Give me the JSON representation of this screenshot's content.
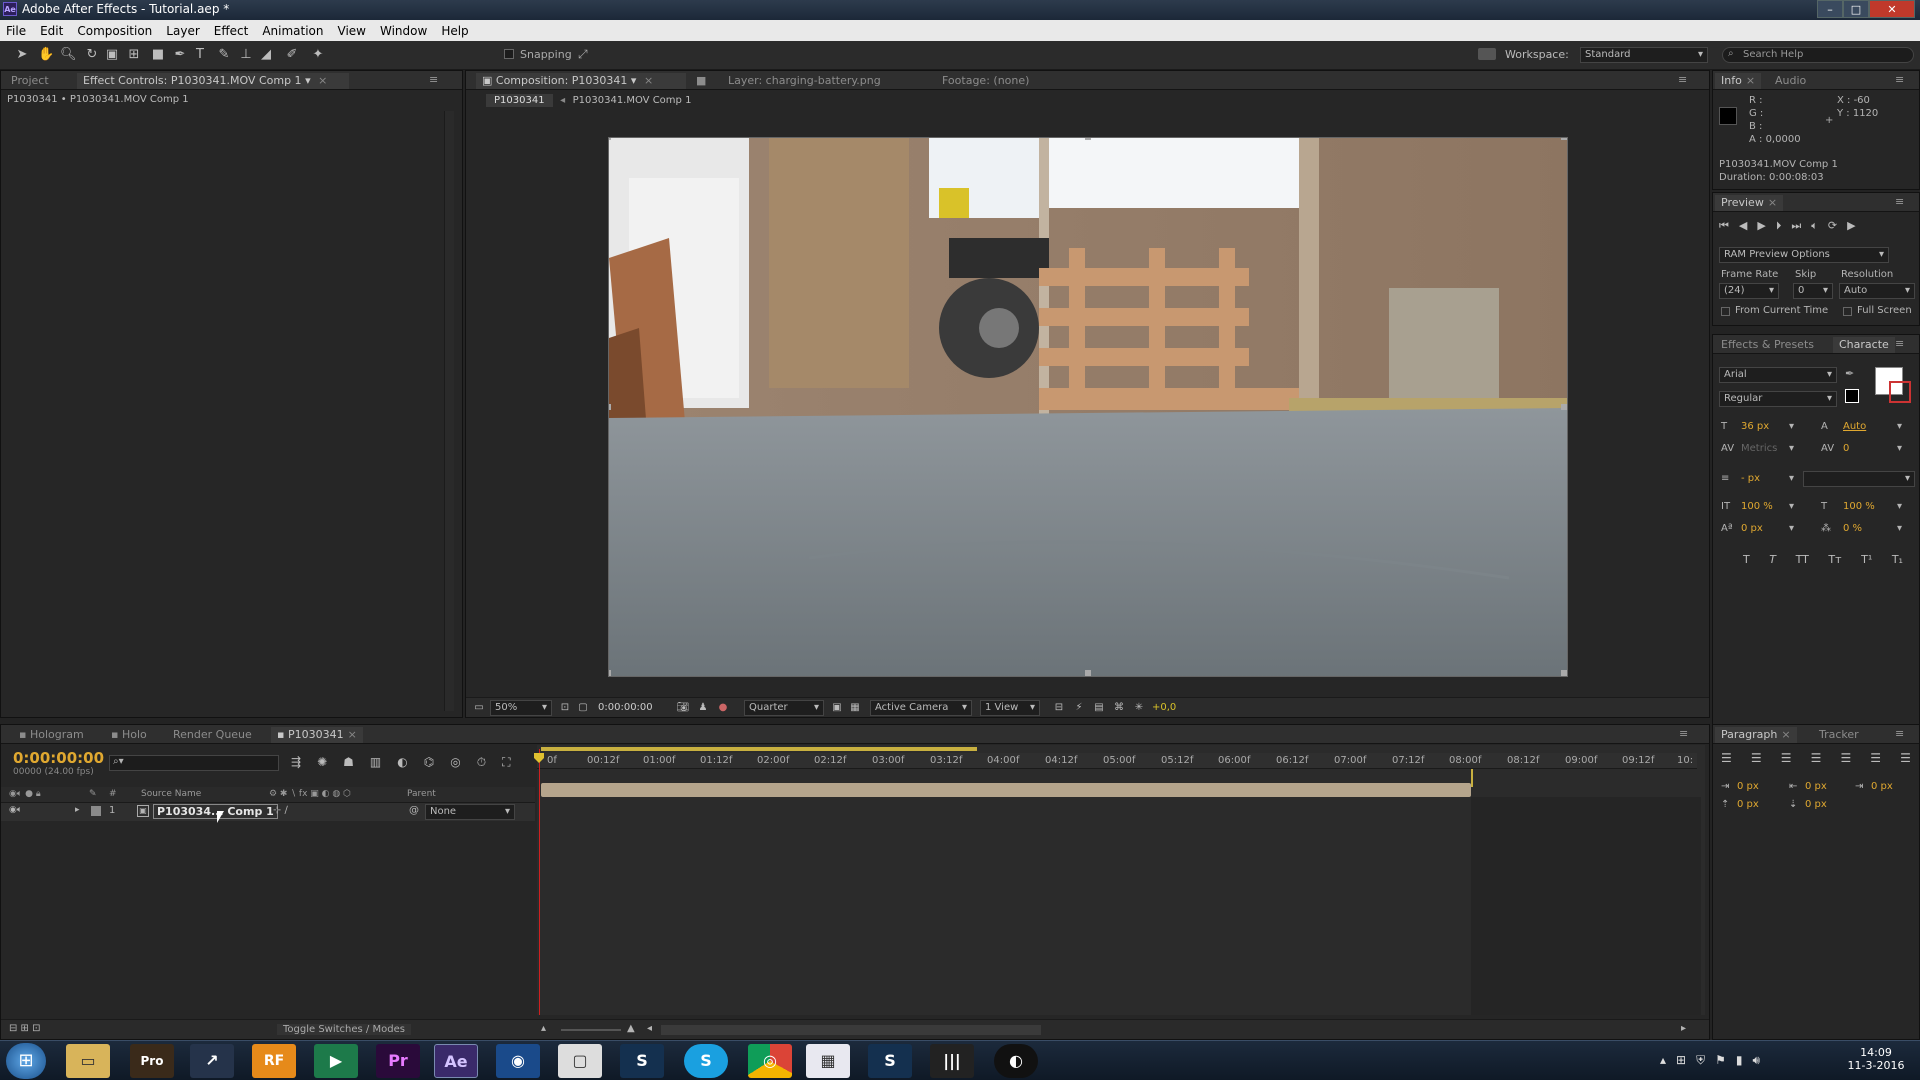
{
  "window": {
    "title": "Adobe After Effects - Tutorial.aep *",
    "controls": [
      "–",
      "□",
      "✕"
    ]
  },
  "menu": [
    "File",
    "Edit",
    "Composition",
    "Layer",
    "Effect",
    "Animation",
    "View",
    "Window",
    "Help"
  ],
  "toolbar": {
    "snapping_label": "Snapping",
    "workspace_label": "Workspace:",
    "workspace_value": "Standard",
    "search_placeholder": "Search Help"
  },
  "left_panel": {
    "tabs": [
      "Project",
      "Effect Controls: P1030341.MOV Comp 1"
    ],
    "breadcrumb": "P1030341 • P1030341.MOV Comp 1"
  },
  "comp_panel": {
    "tabs": [
      "Composition: P1030341",
      "Layer: charging-battery.png",
      "Footage: (none)"
    ],
    "flow": [
      "P1030341",
      "P1030341.MOV Comp 1"
    ],
    "footer": {
      "zoom": "50%",
      "timecode": "0:00:00:00",
      "resolution": "Quarter",
      "camera": "Active Camera",
      "views": "1 View",
      "exposure": "+0,0"
    }
  },
  "info_panel": {
    "tabs": [
      "Info",
      "Audio"
    ],
    "r": "R :",
    "g": "G :",
    "b": "B :",
    "a": "A : 0,0000",
    "x": "X : -60",
    "y": "Y : 1120",
    "comp_name": "P1030341.MOV Comp 1",
    "duration": "Duration: 0:00:08:03"
  },
  "preview_panel": {
    "tab": "Preview",
    "ram_options": "RAM Preview Options",
    "frame_rate_label": "Frame Rate",
    "frame_rate": "(24)",
    "skip_label": "Skip",
    "skip": "0",
    "resolution_label": "Resolution",
    "resolution": "Auto",
    "from_current": "From Current Time",
    "full_screen": "Full Screen"
  },
  "character_panel": {
    "tabs": [
      "Effects & Presets",
      "Characte"
    ],
    "font": "Arial",
    "style": "Regular",
    "size": "36 px",
    "leading": "Auto",
    "tracking_label": "Metrics",
    "kerning": "0",
    "stroke": "- px",
    "vscale": "100 %",
    "hscale": "100 %",
    "baseline": "0 px",
    "tsume": "0 %",
    "text_styles": [
      "T",
      "T",
      "TT",
      "Tт",
      "T¹",
      "T₁"
    ]
  },
  "paragraph_panel": {
    "tabs": [
      "Paragraph",
      "Tracker"
    ],
    "indent_left": "0 px",
    "indent_first": "0 px",
    "indent_right": "0 px",
    "space_before": "0 px",
    "space_after": "0 px"
  },
  "timeline": {
    "tabs": [
      "Hologram",
      "Holo",
      "Render Queue",
      "P1030341"
    ],
    "timecode": "0:00:00:00",
    "frame_info": "00000 (24.00 fps)",
    "columns": {
      "source_name": "Source Name",
      "parent": "Parent"
    },
    "layers": [
      {
        "num": "1",
        "name": "P103034... Comp 1",
        "parent": "None"
      }
    ],
    "ruler": [
      "0f",
      "00:12f",
      "01:00f",
      "01:12f",
      "02:00f",
      "02:12f",
      "03:00f",
      "03:12f",
      "04:00f",
      "04:12f",
      "05:00f",
      "05:12f",
      "06:00f",
      "06:12f",
      "07:00f",
      "07:12f",
      "08:00f",
      "08:12f",
      "09:00f",
      "09:12f",
      "10:"
    ],
    "toggle_label": "Toggle Switches / Modes"
  },
  "taskbar": {
    "apps": [
      "Pro",
      "↗",
      "RF",
      "▶",
      "Pr",
      "Ae",
      "◉",
      "▢",
      "S",
      "S",
      "◎",
      "▦",
      "S",
      "|||",
      "◐"
    ],
    "time": "14:09",
    "date": "11-3-2016"
  }
}
